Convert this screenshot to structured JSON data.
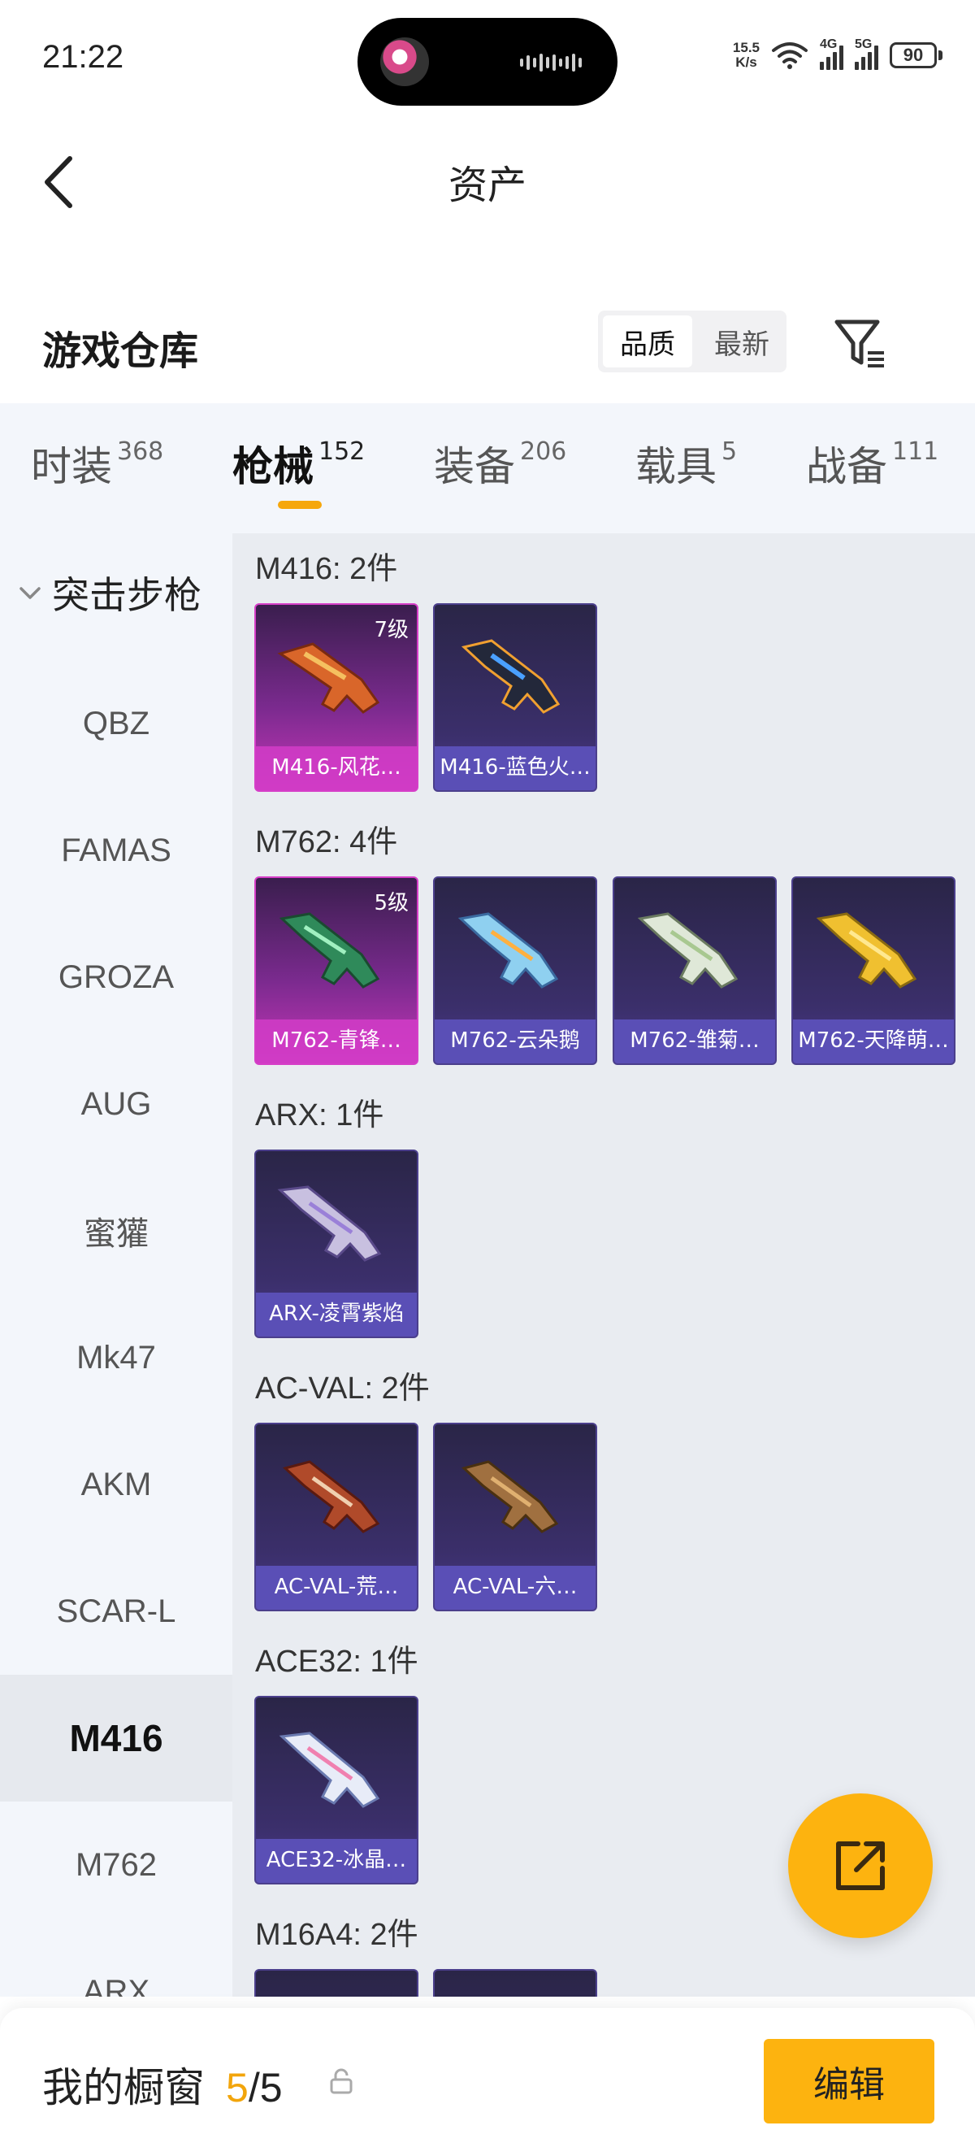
{
  "status_bar": {
    "time": "21:22",
    "net_speed_value": "15.5",
    "net_speed_unit": "K/s",
    "signal1_label": "4G",
    "signal2_label": "5G",
    "battery": "90"
  },
  "header": {
    "title": "资产",
    "back_icon": "chevron-left-icon"
  },
  "warehouse": {
    "title": "游戏仓库",
    "sort_options": [
      "品质",
      "最新"
    ],
    "active_sort": "品质",
    "filter_icon": "filter-icon"
  },
  "tabs": [
    {
      "label": "时装",
      "count": "368"
    },
    {
      "label": "枪械",
      "count": "152"
    },
    {
      "label": "装备",
      "count": "206"
    },
    {
      "label": "载具",
      "count": "5"
    },
    {
      "label": "战备",
      "count": "111"
    }
  ],
  "active_tab": "枪械",
  "sidebar": {
    "category": "突击步枪",
    "items": [
      "QBZ",
      "FAMAS",
      "GROZA",
      "AUG",
      "蜜獾",
      "Mk47",
      "AKM",
      "SCAR-L",
      "M416",
      "M762",
      "ARX"
    ],
    "active_item": "M416"
  },
  "groups": [
    {
      "title": "M416: 2件",
      "items": [
        {
          "name": "M416-风花…",
          "level": "7级",
          "rarity": "pink"
        },
        {
          "name": "M416-蓝色火…",
          "level": "",
          "rarity": "purple"
        }
      ]
    },
    {
      "title": "M762: 4件",
      "items": [
        {
          "name": "M762-青锋…",
          "level": "5级",
          "rarity": "pink"
        },
        {
          "name": "M762-云朵鹅",
          "level": "",
          "rarity": "purple"
        },
        {
          "name": "M762-雏菊…",
          "level": "",
          "rarity": "purple"
        },
        {
          "name": "M762-天降萌…",
          "level": "",
          "rarity": "purple"
        }
      ]
    },
    {
      "title": "ARX: 1件",
      "items": [
        {
          "name": "ARX-凌霄紫焰",
          "level": "",
          "rarity": "purple"
        }
      ]
    },
    {
      "title": "AC-VAL: 2件",
      "items": [
        {
          "name": "AC-VAL-荒…",
          "level": "",
          "rarity": "purple"
        },
        {
          "name": "AC-VAL-六…",
          "level": "",
          "rarity": "purple"
        }
      ]
    },
    {
      "title": "ACE32: 1件",
      "items": [
        {
          "name": "ACE32-冰晶…",
          "level": "",
          "rarity": "purple"
        }
      ]
    },
    {
      "title": "M16A4: 2件",
      "items": []
    }
  ],
  "bottom_bar": {
    "label": "我的橱窗",
    "count_current": "5",
    "count_sep": "/",
    "count_total": "5",
    "edit_button": "编辑"
  },
  "colors": {
    "accent": "#fdb30f",
    "rare_pink": "#c436b6",
    "rare_purple": "#5a4fb6"
  }
}
